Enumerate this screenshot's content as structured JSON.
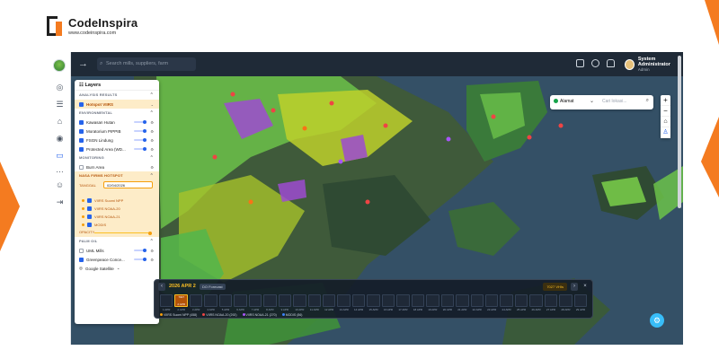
{
  "brand": {
    "name": "CodeInspira",
    "url": "www.codeinspira.com"
  },
  "colors": {
    "accent": "#f47b20",
    "hotspot": "#f59e0b",
    "primary": "#2563eb"
  },
  "topbar": {
    "search_placeholder": "Search mills, suppliers, farm",
    "user_name": "System Administrator",
    "user_role": "Admin"
  },
  "layers": {
    "title": "Layers",
    "analysis_results": "ANALYSIS RESULTS",
    "hotspot_viirs": "Hotspot VIIRS",
    "environmental": "ENVIRONMENTAL",
    "env_items": [
      "Kawasan Hutan",
      "Moratorium PIPPIB",
      "FSGN Lindung",
      "Protected Area (WD..."
    ],
    "monitoring": "MONITORING",
    "burn_area": "Burn Area",
    "hotspot_section": "NASA FIRMS HOTSPOT",
    "tanggal_label": "TANGGAL",
    "tanggal_value": "02/04/2026",
    "hotspot_sources": [
      "VIIRS Suomi NPP",
      "VIIRS NOAA-20",
      "VIIRS NOAA-21",
      "MODIS"
    ],
    "opacity_label": "OPACITY",
    "palm_oil": "PALM OIL",
    "palm_items": [
      "UML Mills",
      "Greenpeace Conce..."
    ],
    "basemap_select": "Google Satellite"
  },
  "place_search": {
    "select_label": "Alamat",
    "placeholder": "Cari lokasi..."
  },
  "timeline": {
    "date": "2026 APR 2",
    "badge": "DO Forecast",
    "right_label": "7027 VHIs",
    "active_bar_top": "7027",
    "active_bar_label": "2 APR",
    "ticks": [
      "1 APR",
      "2 APR",
      "3 APR",
      "4 APR",
      "5 APR",
      "6 APR",
      "7 APR",
      "8 APR",
      "9 APR",
      "10 APR",
      "11 APR",
      "12 APR",
      "13 APR",
      "14 APR",
      "15 APR",
      "16 APR",
      "17 APR",
      "18 APR",
      "19 APR",
      "20 APR",
      "21 APR",
      "22 APR",
      "23 APR",
      "24 APR",
      "25 APR",
      "26 APR",
      "27 APR",
      "28 APR",
      "29 APR"
    ],
    "legend": [
      "VIIRS Suomi NPP (458)",
      "VIIRS NOAA-20 (292)",
      "VIIRS NOAA-21 (270)",
      "MODIS (86)"
    ]
  },
  "icons": [
    "arrow-right-icon",
    "search-icon",
    "fullscreen-icon",
    "moon-icon",
    "bell-icon",
    "layers-icon",
    "gear-icon",
    "home-icon",
    "plus-icon",
    "minus-icon"
  ]
}
